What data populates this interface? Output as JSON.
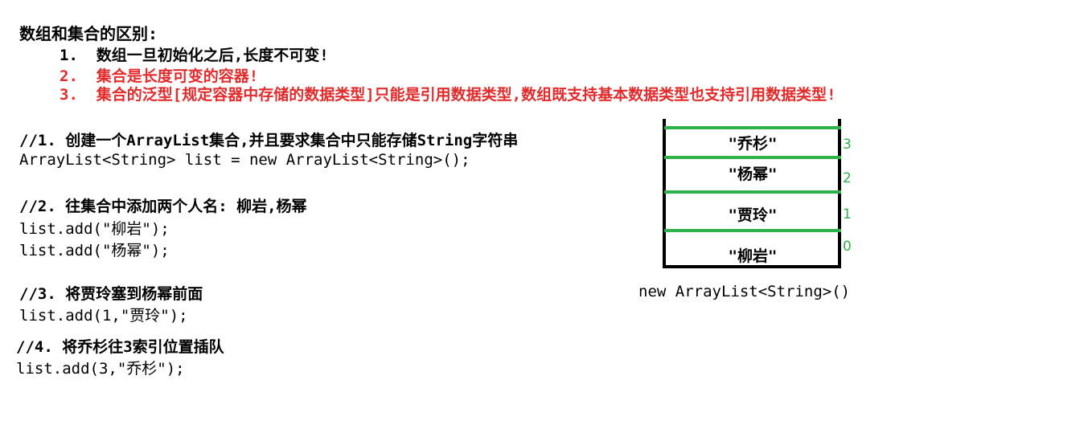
{
  "title": "数组和集合的区别:",
  "differences": [
    {
      "text": "1.  数组一旦初始化之后,长度不可变!",
      "color": "#000000"
    },
    {
      "text": "2.  集合是长度可变的容器!",
      "color": "#e32b2b"
    },
    {
      "text": "3.  集合的泛型[规定容器中存储的数据类型]只能是引用数据类型,数组既支持基本数据类型也支持引用数据类型!",
      "color": "#e32b2b"
    }
  ],
  "code": {
    "step1_comment": "//1. 创建一个ArrayList集合,并且要求集合中只能存储String字符串",
    "step1_line": "ArrayList<String> list = new ArrayList<String>();",
    "step2_comment": "//2. 往集合中添加两个人名: 柳岩,杨幂",
    "step2_line1": "list.add(\"柳岩\");",
    "step2_line2": "list.add(\"杨幂\");",
    "step3_comment": "//3. 将贾玲塞到杨幂前面",
    "step3_line": "list.add(1,\"贾玲\");",
    "step4_comment": "//4. 将乔杉往3索引位置插队",
    "step4_line": "list.add(3,\"乔杉\");"
  },
  "diagram": {
    "elements": [
      {
        "label": "\"乔杉\"",
        "index": "3"
      },
      {
        "label": "\"杨幂\"",
        "index": "2"
      },
      {
        "label": "\"贾玲\"",
        "index": "1"
      },
      {
        "label": "\"柳岩\"",
        "index": "0"
      }
    ],
    "caption": "new ArrayList<String>()",
    "divider_color": "#2db34a"
  }
}
